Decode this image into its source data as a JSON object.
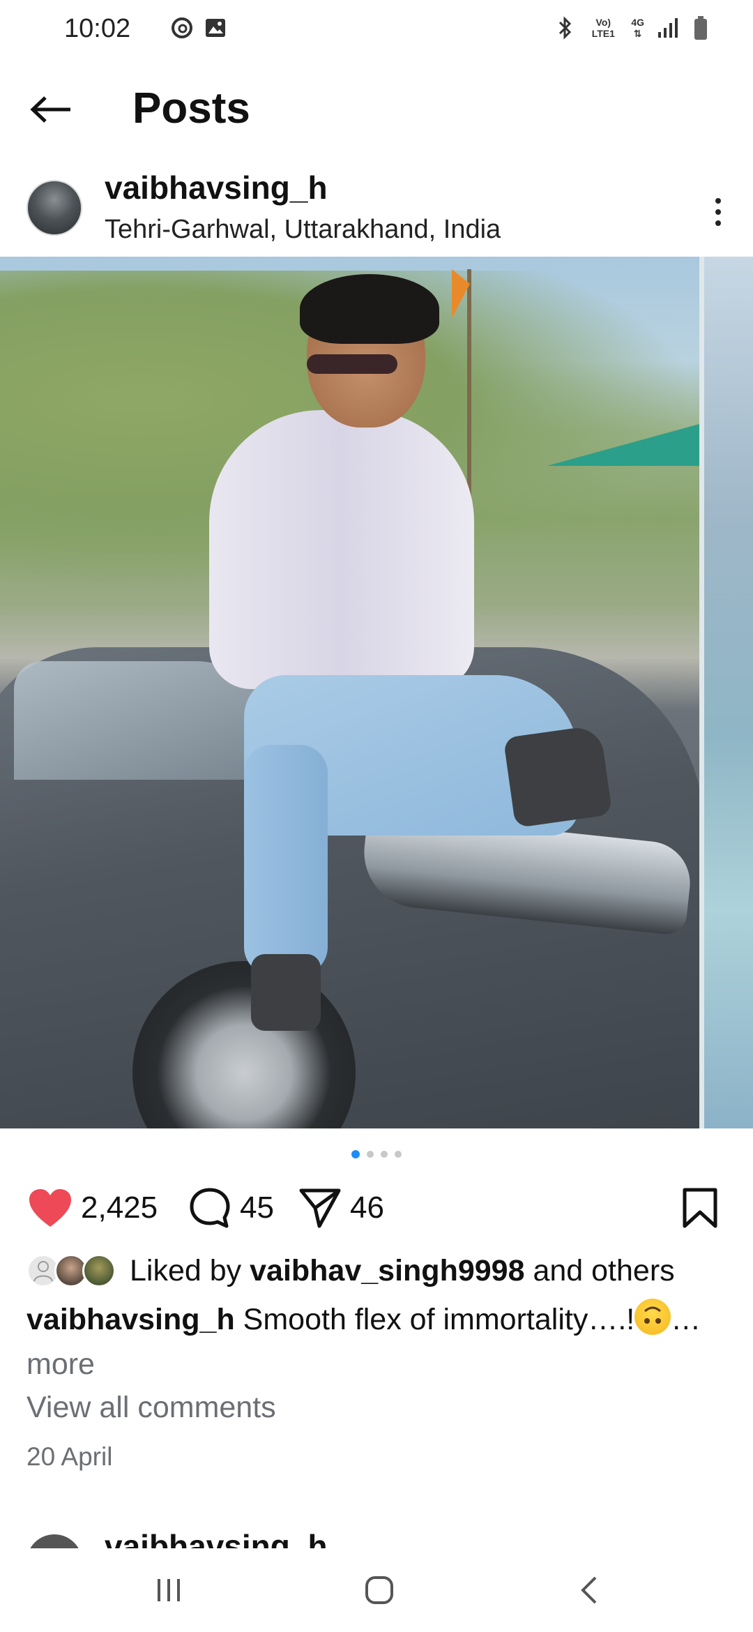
{
  "status_bar": {
    "time": "10:02",
    "network": "Vo) LTE1",
    "net_type": "4G"
  },
  "header": {
    "title": "Posts"
  },
  "post": {
    "username": "vaibhavsing_h",
    "location": "Tehri-Garhwal, Uttarakhand, India",
    "carousel": {
      "total_images": 4,
      "current_index": 1
    },
    "likes_count": "2,425",
    "comments_count": "45",
    "shares_count": "46",
    "liked_by_prefix": "Liked by",
    "liked_by_user": "vaibhav_singh9998",
    "liked_by_suffix": "and others",
    "caption_user": "vaibhavsing_h",
    "caption_text": "Smooth flex of immortality….!",
    "caption_ellipsis": "…",
    "more_label": "more",
    "view_comments": "View all comments",
    "date": "20 April"
  },
  "next_post": {
    "username": "vaibhavsing_h"
  },
  "colors": {
    "like_red": "#ed4956",
    "dot_active": "#1d8cf8",
    "muted_text": "#6b6f74"
  },
  "icons": {
    "back": "arrow-left-icon",
    "more": "more-vertical-icon",
    "like": "heart-icon",
    "comment": "comment-icon",
    "share": "send-icon",
    "save": "bookmark-icon"
  }
}
